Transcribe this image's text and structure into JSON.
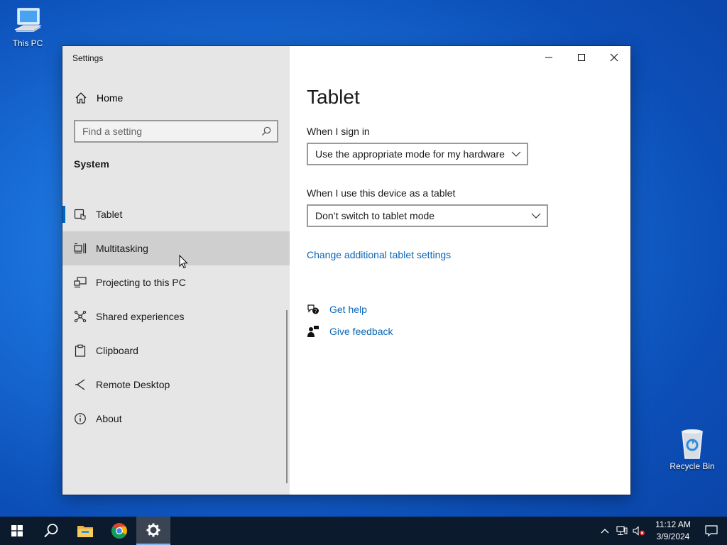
{
  "desktop": {
    "icons": [
      {
        "label": "This PC",
        "icon": "computer-icon"
      },
      {
        "label": "Recycle Bin",
        "icon": "recycle-bin-icon"
      }
    ]
  },
  "window": {
    "title": "Settings",
    "sidebar": {
      "home_label": "Home",
      "search_placeholder": "Find a setting",
      "section_heading": "System",
      "items": [
        {
          "label": "Tablet",
          "icon": "tablet-icon",
          "state": "active"
        },
        {
          "label": "Multitasking",
          "icon": "multitasking-icon",
          "state": "hover"
        },
        {
          "label": "Projecting to this PC",
          "icon": "projecting-icon"
        },
        {
          "label": "Shared experiences",
          "icon": "shared-experiences-icon"
        },
        {
          "label": "Clipboard",
          "icon": "clipboard-icon"
        },
        {
          "label": "Remote Desktop",
          "icon": "remote-desktop-icon"
        },
        {
          "label": "About",
          "icon": "info-icon"
        }
      ]
    },
    "content": {
      "page_title": "Tablet",
      "sign_in_label": "When I sign in",
      "sign_in_value": "Use the appropriate mode for my hardware",
      "tablet_use_label": "When I use this device as a tablet",
      "tablet_use_value": "Don’t switch to tablet mode",
      "additional_link": "Change additional tablet settings",
      "get_help": "Get help",
      "give_feedback": "Give feedback"
    }
  },
  "taskbar": {
    "apps": [
      "start-icon",
      "search-icon",
      "file-explorer-icon",
      "chrome-icon",
      "settings-icon"
    ],
    "clock_time": "11:12 AM",
    "clock_date": "3/9/2024"
  },
  "colors": {
    "accent": "#0067c0",
    "link": "#0a66b7",
    "taskbar": "#0b1a2c",
    "sidebar": "#e6e6e6"
  }
}
